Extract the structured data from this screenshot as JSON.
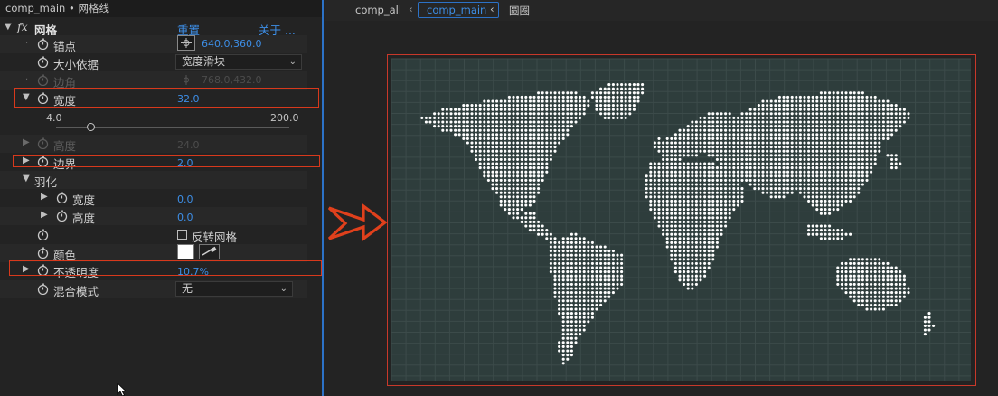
{
  "panel": {
    "title": "comp_main • 网格线",
    "effect": {
      "fx_label": "fx",
      "name": "网格",
      "reset": "重置",
      "about": "关于 ..."
    },
    "rows": {
      "anchor": {
        "label": "锚点",
        "value": "640.0,360.0"
      },
      "size_from": {
        "label": "大小依据",
        "value": "宽度滑块"
      },
      "corner": {
        "label": "边角",
        "value": "768.0,432.0"
      },
      "width": {
        "label": "宽度",
        "value": "32.0"
      },
      "height": {
        "label": "高度",
        "value": "24.0"
      },
      "border": {
        "label": "边界",
        "value": "2.0"
      },
      "feather": {
        "label": "羽化"
      },
      "feather_width": {
        "label": "宽度",
        "value": "0.0"
      },
      "feather_height": {
        "label": "高度",
        "value": "0.0"
      },
      "invert": {
        "label": "反转网格",
        "checked": false
      },
      "color": {
        "label": "颜色",
        "value": "#ffffff"
      },
      "opacity": {
        "label": "不透明度",
        "value": "10.7%"
      },
      "blend": {
        "label": "混合模式",
        "value": "无"
      }
    },
    "slider": {
      "min_label": "4.0",
      "max_label": "200.0",
      "min": 4.0,
      "max": 200.0,
      "value": 32.0
    }
  },
  "viewer": {
    "tabs": {
      "first": "comp_all",
      "active": "comp_main",
      "after": "圆圈"
    },
    "comp_background": "#2e3d3c",
    "grid_color": "#3c4b4a",
    "dot_color": "#ffffff",
    "arrow_color": "#e0401c"
  },
  "colors": {
    "accent": "#2c72c7",
    "value_blue": "#3d8ee6",
    "highlight": "#d8391c"
  }
}
